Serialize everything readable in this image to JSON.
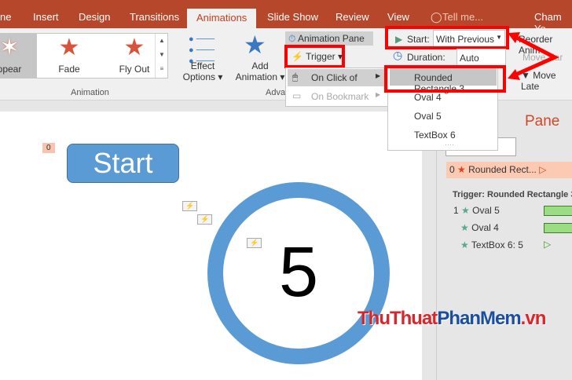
{
  "tabs": [
    "ne",
    "Insert",
    "Design",
    "Transitions",
    "Animations",
    "Slide Show",
    "Review",
    "View"
  ],
  "tell_me": "Tell me...",
  "user": "Cham Yo",
  "gallery": [
    {
      "label": "ppear"
    },
    {
      "label": "Fade"
    },
    {
      "label": "Fly Out"
    }
  ],
  "effect_options": [
    "Effect",
    "Options"
  ],
  "add_animation": [
    "Add",
    "Animation"
  ],
  "group_animation": "Animation",
  "group_advanced": "Adva",
  "animation_pane_btn": "Animation Pane",
  "trigger_btn": "Trigger",
  "trigger_menu": {
    "on_click": "On Click of",
    "on_bookmark": "On Bookmark"
  },
  "start_label": "Start:",
  "start_value": "With Previous",
  "duration_label": "Duration:",
  "duration_value": "Auto",
  "reorder": "Reorder Anim",
  "move_earlier": "Move Ear",
  "move_later": "Move Late",
  "submenu": [
    "Rounded Rectangle 3",
    "Oval 4",
    "Oval 5",
    "TextBox 6"
  ],
  "slide": {
    "badge": "0",
    "start_button": "Start",
    "number": "5"
  },
  "pane": {
    "title": "Pane",
    "item0": {
      "num": "0",
      "label": "Rounded Rect..."
    },
    "trigger_header": "Trigger: Rounded Rectangle 3",
    "items": [
      {
        "num": "1",
        "label": "Oval 5"
      },
      {
        "num": "",
        "label": "Oval 4"
      },
      {
        "num": "",
        "label": "TextBox 6: 5"
      }
    ]
  },
  "watermark": "ThuThuatPhanMem.vn",
  "colors": {
    "accent": "#b7472a",
    "highlight": "#ff0000"
  }
}
